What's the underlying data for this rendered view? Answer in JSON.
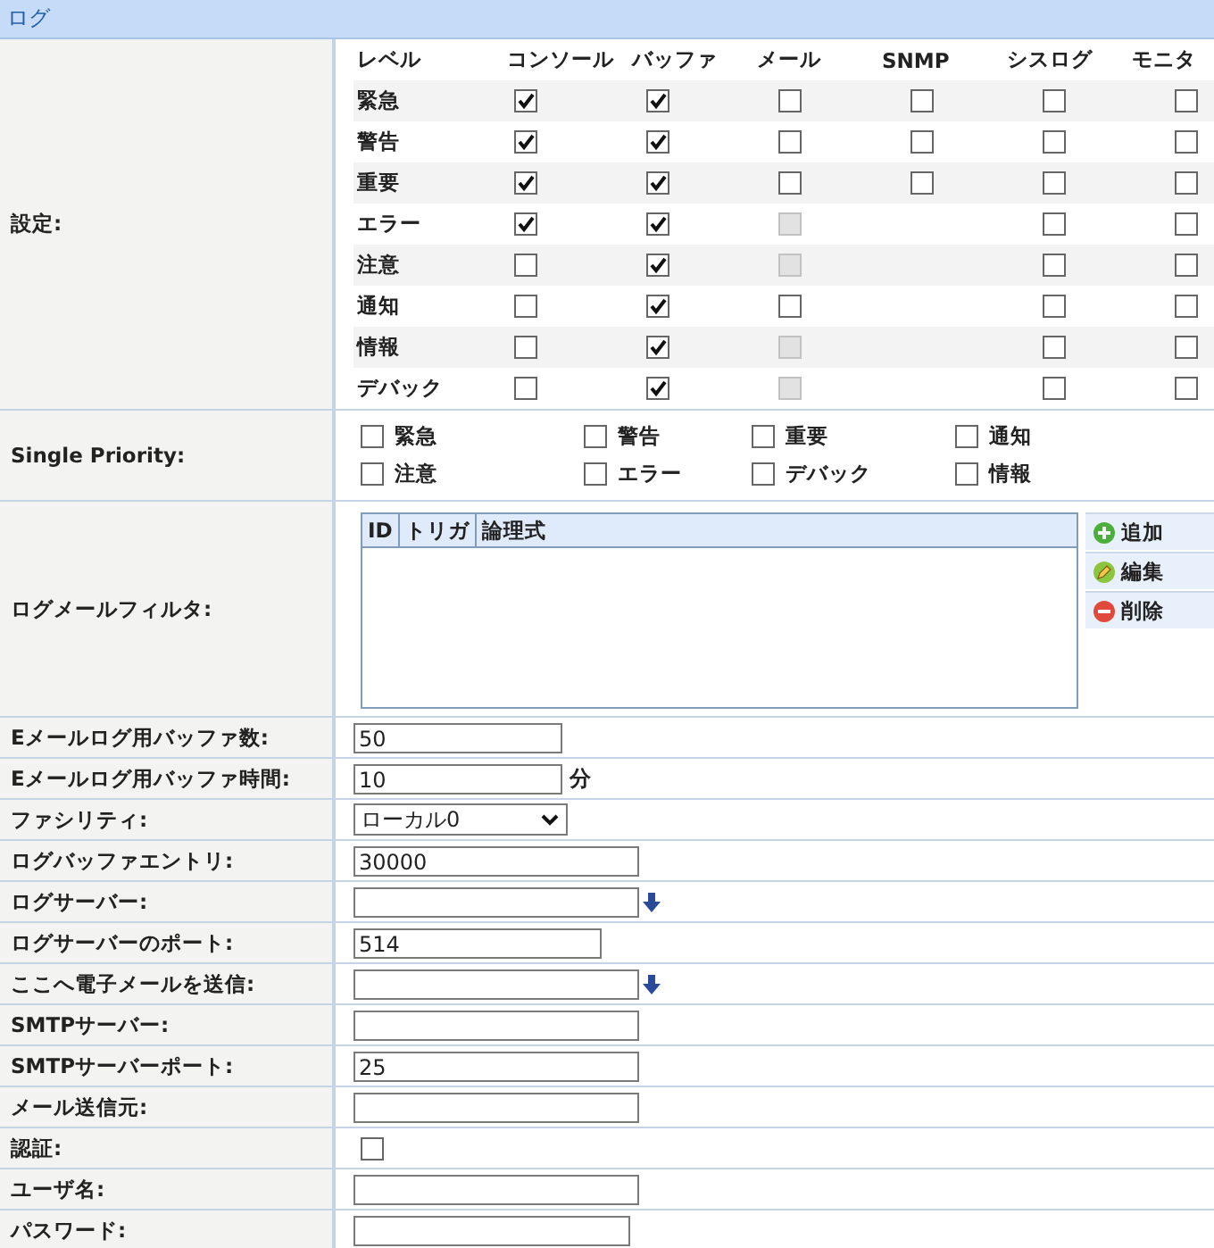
{
  "section_title": "ログ",
  "settings": {
    "label": "設定:",
    "columns": [
      "レベル",
      "コンソール",
      "バッファ",
      "メール",
      "SNMP",
      "シスログ",
      "モニタ"
    ],
    "levels": [
      {
        "label": "緊急",
        "cells": [
          {
            "kind": "checkbox",
            "checked": true,
            "disabled": false
          },
          {
            "kind": "checkbox",
            "checked": true,
            "disabled": false
          },
          {
            "kind": "checkbox",
            "checked": false,
            "disabled": false
          },
          {
            "kind": "checkbox",
            "checked": false,
            "disabled": false
          },
          {
            "kind": "checkbox",
            "checked": false,
            "disabled": false
          },
          {
            "kind": "checkbox",
            "checked": false,
            "disabled": false
          }
        ]
      },
      {
        "label": "警告",
        "cells": [
          {
            "kind": "checkbox",
            "checked": true,
            "disabled": false
          },
          {
            "kind": "checkbox",
            "checked": true,
            "disabled": false
          },
          {
            "kind": "checkbox",
            "checked": false,
            "disabled": false
          },
          {
            "kind": "checkbox",
            "checked": false,
            "disabled": false
          },
          {
            "kind": "checkbox",
            "checked": false,
            "disabled": false
          },
          {
            "kind": "checkbox",
            "checked": false,
            "disabled": false
          }
        ]
      },
      {
        "label": "重要",
        "cells": [
          {
            "kind": "checkbox",
            "checked": true,
            "disabled": false
          },
          {
            "kind": "checkbox",
            "checked": true,
            "disabled": false
          },
          {
            "kind": "checkbox",
            "checked": false,
            "disabled": false
          },
          {
            "kind": "checkbox",
            "checked": false,
            "disabled": false
          },
          {
            "kind": "checkbox",
            "checked": false,
            "disabled": false
          },
          {
            "kind": "checkbox",
            "checked": false,
            "disabled": false
          }
        ]
      },
      {
        "label": "エラー",
        "cells": [
          {
            "kind": "checkbox",
            "checked": true,
            "disabled": false
          },
          {
            "kind": "checkbox",
            "checked": true,
            "disabled": false
          },
          {
            "kind": "checkbox",
            "checked": false,
            "disabled": true
          },
          {
            "kind": "blank"
          },
          {
            "kind": "checkbox",
            "checked": false,
            "disabled": false
          },
          {
            "kind": "checkbox",
            "checked": false,
            "disabled": false
          }
        ]
      },
      {
        "label": "注意",
        "cells": [
          {
            "kind": "checkbox",
            "checked": false,
            "disabled": false
          },
          {
            "kind": "checkbox",
            "checked": true,
            "disabled": false
          },
          {
            "kind": "checkbox",
            "checked": false,
            "disabled": true
          },
          {
            "kind": "blank"
          },
          {
            "kind": "checkbox",
            "checked": false,
            "disabled": false
          },
          {
            "kind": "checkbox",
            "checked": false,
            "disabled": false
          }
        ]
      },
      {
        "label": "通知",
        "cells": [
          {
            "kind": "checkbox",
            "checked": false,
            "disabled": false
          },
          {
            "kind": "checkbox",
            "checked": true,
            "disabled": false
          },
          {
            "kind": "checkbox",
            "checked": false,
            "disabled": false
          },
          {
            "kind": "blank"
          },
          {
            "kind": "checkbox",
            "checked": false,
            "disabled": false
          },
          {
            "kind": "checkbox",
            "checked": false,
            "disabled": false
          }
        ]
      },
      {
        "label": "情報",
        "cells": [
          {
            "kind": "checkbox",
            "checked": false,
            "disabled": false
          },
          {
            "kind": "checkbox",
            "checked": true,
            "disabled": false
          },
          {
            "kind": "checkbox",
            "checked": false,
            "disabled": true
          },
          {
            "kind": "blank"
          },
          {
            "kind": "checkbox",
            "checked": false,
            "disabled": false
          },
          {
            "kind": "checkbox",
            "checked": false,
            "disabled": false
          }
        ]
      },
      {
        "label": "デバック",
        "cells": [
          {
            "kind": "checkbox",
            "checked": false,
            "disabled": false
          },
          {
            "kind": "checkbox",
            "checked": true,
            "disabled": false
          },
          {
            "kind": "checkbox",
            "checked": false,
            "disabled": true
          },
          {
            "kind": "blank"
          },
          {
            "kind": "checkbox",
            "checked": false,
            "disabled": false
          },
          {
            "kind": "checkbox",
            "checked": false,
            "disabled": false
          }
        ]
      }
    ]
  },
  "single_priority": {
    "label": "Single Priority:",
    "items": [
      {
        "label": "緊急",
        "checked": false
      },
      {
        "label": "警告",
        "checked": false
      },
      {
        "label": "重要",
        "checked": false
      },
      {
        "label": "通知",
        "checked": false
      },
      {
        "label": "注意",
        "checked": false
      },
      {
        "label": "エラー",
        "checked": false
      },
      {
        "label": "デバック",
        "checked": false
      },
      {
        "label": "情報",
        "checked": false
      }
    ]
  },
  "mail_filter": {
    "label": "ログメールフィルタ:",
    "columns": [
      "ID",
      "トリガ",
      "論理式"
    ],
    "buttons": [
      {
        "label": "追加",
        "kind": "add"
      },
      {
        "label": "編集",
        "kind": "edit"
      },
      {
        "label": "削除",
        "kind": "delete"
      }
    ]
  },
  "fields": [
    {
      "label": "Eメールログ用バッファ数:",
      "kind": "text",
      "value": "50"
    },
    {
      "label": "Eメールログ用バッファ時間:",
      "kind": "text",
      "value": "10",
      "suffix": "分"
    },
    {
      "label": "ファシリティ:",
      "kind": "select",
      "value": "ローカル0"
    },
    {
      "label": "ログバッファエントリ:",
      "kind": "text",
      "value": "30000"
    },
    {
      "label": "ログサーバー:",
      "kind": "text",
      "picker": true
    },
    {
      "label": "ログサーバーのポート:",
      "kind": "text",
      "value": "514"
    },
    {
      "label": "ここへ電子メールを送信:",
      "kind": "text",
      "picker": true
    },
    {
      "label": "SMTPサーバー:",
      "kind": "text"
    },
    {
      "label": "SMTPサーバーポート:",
      "kind": "text",
      "value": "25"
    },
    {
      "label": "メール送信元:",
      "kind": "text"
    },
    {
      "label": "認証:",
      "kind": "checkbox",
      "checked": false
    },
    {
      "label": "ユーザ名:",
      "kind": "text"
    },
    {
      "label": "パスワード:",
      "kind": "text"
    }
  ]
}
